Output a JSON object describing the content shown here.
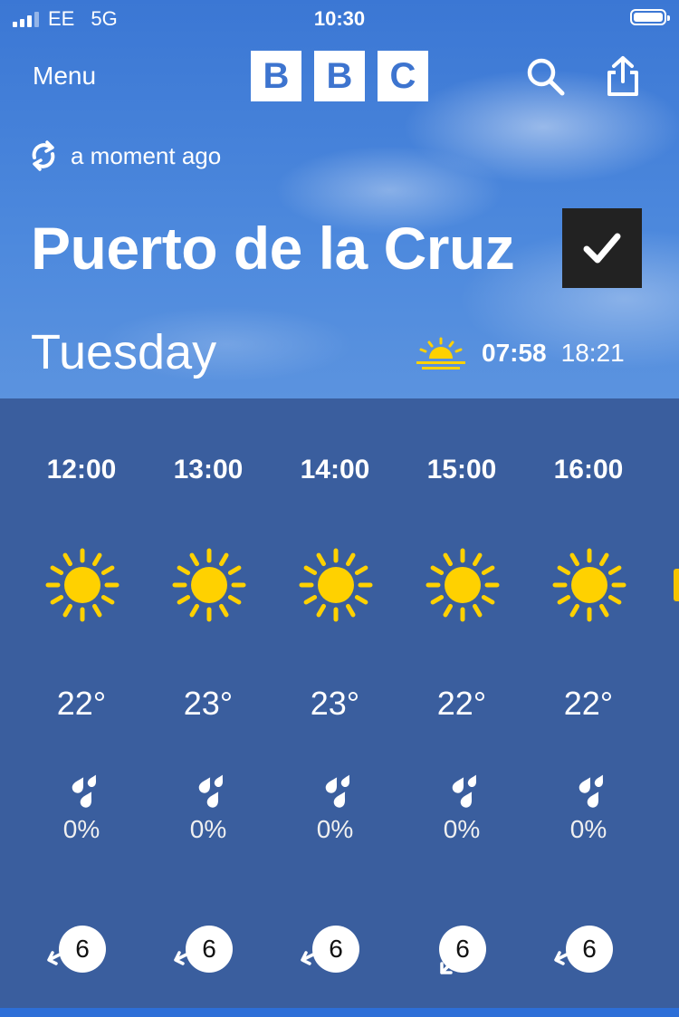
{
  "status_bar": {
    "carrier": "EE",
    "network": "5G",
    "time": "10:30"
  },
  "header": {
    "menu_label": "Menu",
    "logo_letters": [
      "B",
      "B",
      "C"
    ]
  },
  "update": {
    "text": "a moment ago"
  },
  "location": {
    "name": "Puerto de la Cruz",
    "favourite": true
  },
  "day": {
    "name": "Tuesday",
    "sunrise": "07:58",
    "sunset": "18:21"
  },
  "hours": [
    {
      "time": "12:00",
      "icon": "sunny-icon",
      "temp": "22°",
      "rain": "0%",
      "wind": "6",
      "wind_arrow": "left"
    },
    {
      "time": "13:00",
      "icon": "sunny-icon",
      "temp": "23°",
      "rain": "0%",
      "wind": "6",
      "wind_arrow": "left"
    },
    {
      "time": "14:00",
      "icon": "sunny-icon",
      "temp": "23°",
      "rain": "0%",
      "wind": "6",
      "wind_arrow": "left"
    },
    {
      "time": "15:00",
      "icon": "sunny-icon",
      "temp": "22°",
      "rain": "0%",
      "wind": "6",
      "wind_arrow": "down-left"
    },
    {
      "time": "16:00",
      "icon": "sunny-icon",
      "temp": "22°",
      "rain": "0%",
      "wind": "6",
      "wind_arrow": "left"
    }
  ],
  "colors": {
    "sun": "#ffd100",
    "panel": "#3a5e9e",
    "sky": "#4a86de"
  }
}
